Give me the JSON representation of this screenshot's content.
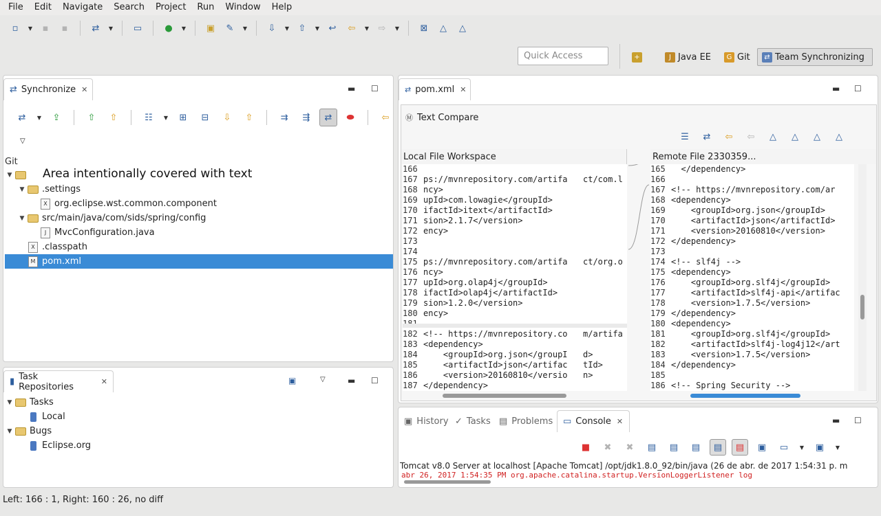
{
  "menu": [
    "File",
    "Edit",
    "Navigate",
    "Search",
    "Project",
    "Run",
    "Window",
    "Help"
  ],
  "quick_access": {
    "placeholder": "Quick Access"
  },
  "perspectives": [
    {
      "label": "Java EE",
      "icon": "java-ee-perspective-icon"
    },
    {
      "label": "Git",
      "icon": "git-perspective-icon"
    },
    {
      "label": "Team Synchronizing",
      "icon": "team-sync-perspective-icon",
      "active": true
    }
  ],
  "sync_view": {
    "tab_label": "Synchronize",
    "git_label": "Git",
    "overlay": "Area intentionally covered with text",
    "tree": [
      {
        "label": ".settings",
        "depth": 1,
        "type": "folder",
        "expanded": true
      },
      {
        "label": "org.eclipse.wst.common.component",
        "depth": 2,
        "type": "xml-file"
      },
      {
        "label": "src/main/java/com/sids/spring/config",
        "depth": 1,
        "type": "folder",
        "expanded": true
      },
      {
        "label": "MvcConfiguration.java",
        "depth": 2,
        "type": "java-file"
      },
      {
        "label": ".classpath",
        "depth": 1,
        "type": "xml-file"
      },
      {
        "label": "pom.xml",
        "depth": 1,
        "type": "pom-file",
        "selected": true
      }
    ]
  },
  "task_repositories": {
    "tab_label": "Task Repositories",
    "tree": [
      {
        "label": "Tasks",
        "depth": 0,
        "type": "folder"
      },
      {
        "label": "Local",
        "depth": 1,
        "type": "repo"
      },
      {
        "label": "Bugs",
        "depth": 0,
        "type": "folder"
      },
      {
        "label": "Eclipse.org",
        "depth": 1,
        "type": "repo"
      }
    ]
  },
  "editor": {
    "tab_label": "pom.xml",
    "compare_title": "Text Compare",
    "left_header": "Local File Workspace",
    "right_header": "Remote File 2330359...",
    "left_lines": [
      {
        "n": "166",
        "t": ""
      },
      {
        "n": "167",
        "t": "ps://mvnrepository.com/artifa"
      },
      {
        "n": "168",
        "t": "ncy>"
      },
      {
        "n": "169",
        "t": "upId>com.lowagie</groupId>"
      },
      {
        "n": "170",
        "t": "ifactId>itext</artifactId>"
      },
      {
        "n": "171",
        "t": "sion>2.1.7</version>"
      },
      {
        "n": "172",
        "t": "ency>"
      },
      {
        "n": "173",
        "t": ""
      },
      {
        "n": "174",
        "t": ""
      },
      {
        "n": "175",
        "t": "ps://mvnrepository.com/artifa"
      },
      {
        "n": "176",
        "t": "ncy>"
      },
      {
        "n": "177",
        "t": "upId>org.olap4j</groupId>"
      },
      {
        "n": "178",
        "t": "ifactId>olap4j</artifactId>"
      },
      {
        "n": "179",
        "t": "sion>1.2.0</version>"
      },
      {
        "n": "180",
        "t": "ency>"
      },
      {
        "n": "181",
        "t": ""
      },
      {
        "n": "182",
        "t": "<!-- https://mvnrepository.co"
      },
      {
        "n": "183",
        "t": "<dependency>"
      },
      {
        "n": "184",
        "t": "    <groupId>org.json</groupI"
      },
      {
        "n": "185",
        "t": "    <artifactId>json</artifac"
      },
      {
        "n": "186",
        "t": "    <version>20160810</versio"
      },
      {
        "n": "187",
        "t": "</dependency>"
      }
    ],
    "left_fragments": [
      {
        "line": 1,
        "t": "ct/com.l"
      },
      {
        "line": 9,
        "t": "ct/org.o"
      },
      {
        "line": 16,
        "t": "m/artifa"
      },
      {
        "line": 18,
        "t": "d>"
      },
      {
        "line": 19,
        "t": "tId>"
      },
      {
        "line": 20,
        "t": "n>"
      }
    ],
    "right_lines": [
      {
        "n": "165",
        "t": "  </dependency>"
      },
      {
        "n": "166",
        "t": ""
      },
      {
        "n": "167",
        "t": "<!-- https://mvnrepository.com/ar"
      },
      {
        "n": "168",
        "t": "<dependency>"
      },
      {
        "n": "169",
        "t": "    <groupId>org.json</groupId>"
      },
      {
        "n": "170",
        "t": "    <artifactId>json</artifactId>"
      },
      {
        "n": "171",
        "t": "    <version>20160810</version>"
      },
      {
        "n": "172",
        "t": "</dependency>"
      },
      {
        "n": "173",
        "t": ""
      },
      {
        "n": "174",
        "t": "<!-- slf4j -->"
      },
      {
        "n": "175",
        "t": "<dependency>"
      },
      {
        "n": "176",
        "t": "    <groupId>org.slf4j</groupId>"
      },
      {
        "n": "177",
        "t": "    <artifactId>slf4j-api</artifac"
      },
      {
        "n": "178",
        "t": "    <version>1.7.5</version>"
      },
      {
        "n": "179",
        "t": "</dependency>"
      },
      {
        "n": "180",
        "t": "<dependency>"
      },
      {
        "n": "181",
        "t": "    <groupId>org.slf4j</groupId>"
      },
      {
        "n": "182",
        "t": "    <artifactId>slf4j-log4j12</art"
      },
      {
        "n": "183",
        "t": "    <version>1.7.5</version>"
      },
      {
        "n": "184",
        "t": "</dependency>"
      },
      {
        "n": "185",
        "t": ""
      },
      {
        "n": "186",
        "t": "<!-- Spring Security -->"
      }
    ]
  },
  "console": {
    "tabs": [
      "History",
      "Tasks",
      "Problems",
      "Console"
    ],
    "active": "Console",
    "title": "Tomcat v8.0 Server at localhost [Apache Tomcat] /opt/jdk1.8.0_92/bin/java (26 de abr. de 2017 1:54:31 p. m",
    "log": "abr 26, 2017 1:54:35 PM org.apache.catalina.startup.VersionLoggerListener log",
    "log_color": "#d02020"
  },
  "status": "Left: 166 : 1, Right: 160 : 26, no diff"
}
